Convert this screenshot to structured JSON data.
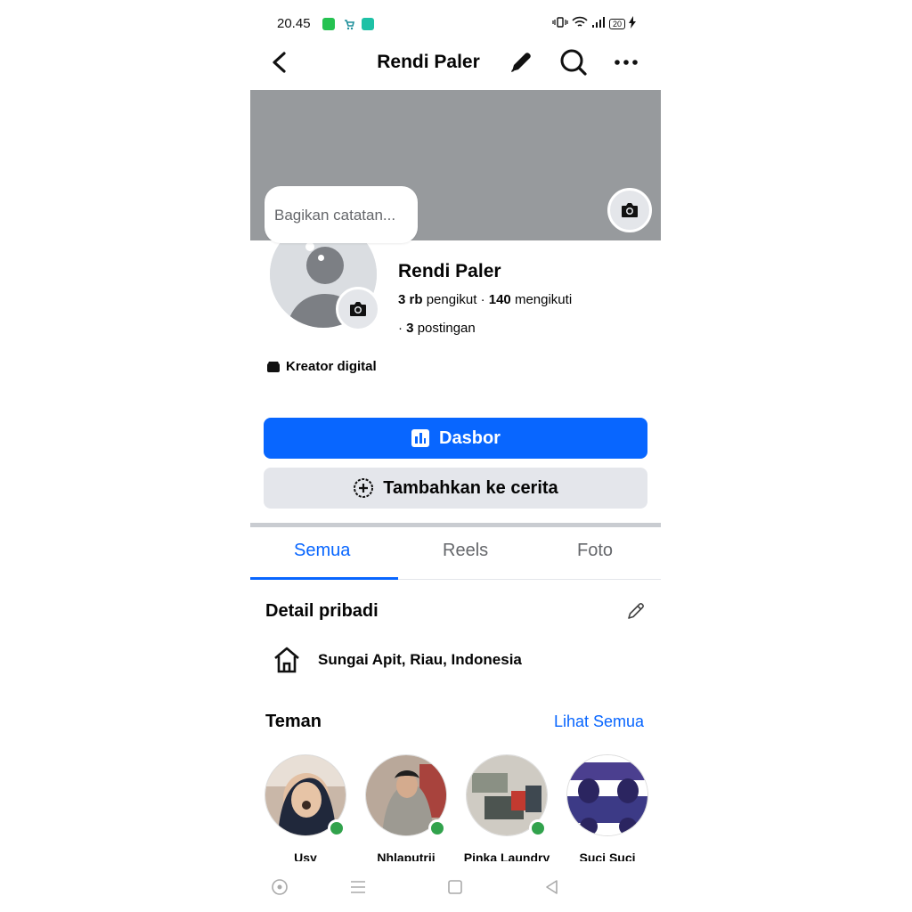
{
  "status_bar": {
    "time": "20.45",
    "battery": "20",
    "notification_icons": [
      "app-notification-icon",
      "shopping-notification-icon",
      "message-notification-icon"
    ]
  },
  "header": {
    "title": "Rendi Paler"
  },
  "note": {
    "placeholder": "Bagikan catatan..."
  },
  "profile": {
    "name": "Rendi Paler",
    "followers_count": "3 rb",
    "followers_label": "pengikut",
    "following_count": "140",
    "following_label": "mengikuti",
    "posts_count": "3",
    "posts_label": "postingan",
    "category": "Kreator digital"
  },
  "buttons": {
    "dashboard": "Dasbor",
    "add_story": "Tambahkan ke cerita"
  },
  "tabs": [
    {
      "label": "Semua",
      "active": true
    },
    {
      "label": "Reels",
      "active": false
    },
    {
      "label": "Foto",
      "active": false
    }
  ],
  "details": {
    "title": "Detail pribadi",
    "location": "Sungai Apit, Riau, Indonesia"
  },
  "friends": {
    "title": "Teman",
    "see_all": "Lihat Semua",
    "items": [
      {
        "name": "Usy",
        "online": true
      },
      {
        "name": "Nhlaputrii",
        "online": true
      },
      {
        "name": "Pinka Laundry",
        "online": true
      },
      {
        "name": "Suci Suci",
        "online": false
      }
    ]
  },
  "colors": {
    "accent": "#0866ff",
    "cover": "#979a9d",
    "online": "#31a24c",
    "secondary_button": "#e4e6eb"
  }
}
